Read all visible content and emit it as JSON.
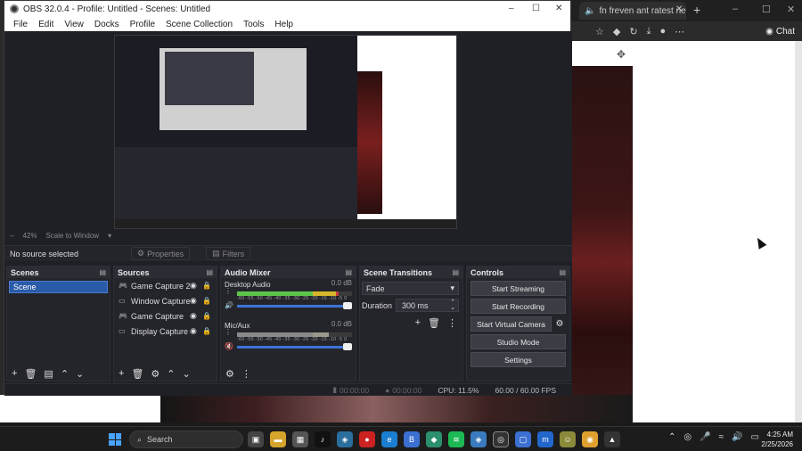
{
  "obs": {
    "title": "OBS 32.0.4 - Profile: Untitled - Scenes: Untitled",
    "menu": [
      "File",
      "Edit",
      "View",
      "Docks",
      "Profile",
      "Scene Collection",
      "Tools",
      "Help"
    ],
    "zoom": {
      "level": "42%",
      "scale_mode": "Scale to Window"
    },
    "no_source_label": "No source selected",
    "properties_label": "Properties",
    "filters_label": "Filters",
    "scenes": {
      "title": "Scenes",
      "items": [
        "Scene"
      ]
    },
    "sources": {
      "title": "Sources",
      "items": [
        {
          "name": "Game Capture 2",
          "icon": "gamepad-icon"
        },
        {
          "name": "Window Capture",
          "icon": "window-icon"
        },
        {
          "name": "Game Capture",
          "icon": "gamepad-icon"
        },
        {
          "name": "Display Capture",
          "icon": "monitor-icon"
        }
      ]
    },
    "mixer": {
      "title": "Audio Mixer",
      "channels": [
        {
          "name": "Desktop Audio",
          "db": "0.0 dB",
          "muted": false,
          "level": 0.88,
          "volume": 1.0
        },
        {
          "name": "Mic/Aux",
          "db": "0.0 dB",
          "muted": true,
          "level": 0.8,
          "volume": 1.0
        }
      ],
      "scale": "-60 -55 -50 -45 -40 -35 -30 -25 -20 -15 -10 -5 0"
    },
    "transitions": {
      "title": "Scene Transitions",
      "type": "Fade",
      "duration_label": "Duration",
      "duration_value": "300 ms"
    },
    "controls": {
      "title": "Controls",
      "start_streaming": "Start Streaming",
      "start_recording": "Start Recording",
      "start_virtual_camera": "Start Virtual Camera",
      "studio_mode": "Studio Mode",
      "settings": "Settings"
    },
    "status": {
      "stream_time": "00:00:00",
      "record_time": "00:00:00",
      "cpu": "CPU: 11.5%",
      "fps": "60.00 / 60.00 FPS"
    }
  },
  "browser": {
    "tab_title": "fn freven ant ratest new",
    "chat_label": "Chat"
  },
  "taskbar": {
    "search_placeholder": "Search",
    "time": "4:25 AM",
    "date": "2/25/2026"
  },
  "colors": {
    "accent": "#2a5ba9",
    "meter_green": "#5ec54b",
    "meter_yellow": "#d6b72a",
    "meter_red": "#c23b3b",
    "muted_red": "#d04040"
  }
}
